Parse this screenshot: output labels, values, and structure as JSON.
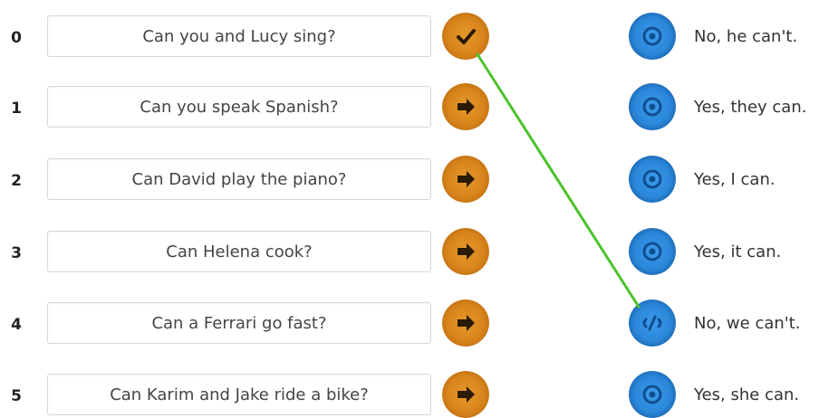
{
  "rows": [
    {
      "number": "0",
      "question": "Can you and Lucy sing?",
      "question_state": "checked",
      "answer": "No, he can't.",
      "answer_state": "empty"
    },
    {
      "number": "1",
      "question": "Can you speak Spanish?",
      "question_state": "arrow",
      "answer": "Yes, they can.",
      "answer_state": "empty"
    },
    {
      "number": "2",
      "question": "Can David play the piano?",
      "question_state": "arrow",
      "answer": "Yes, I can.",
      "answer_state": "empty"
    },
    {
      "number": "3",
      "question": "Can Helena cook?",
      "question_state": "arrow",
      "answer": "Yes, it can.",
      "answer_state": "empty"
    },
    {
      "number": "4",
      "question": "Can a Ferrari go fast?",
      "question_state": "arrow",
      "answer": "No, we can't.",
      "answer_state": "linked"
    },
    {
      "number": "5",
      "question": "Can Karim and Jake ride a bike?",
      "question_state": "arrow",
      "answer": "Yes, she can.",
      "answer_state": "empty"
    }
  ],
  "connection": {
    "from_row": 0,
    "to_row": 4
  },
  "colors": {
    "orange_button": "#d8841c",
    "blue_button": "#2a86d8",
    "connection_line": "#4cc22c"
  },
  "icons": {
    "question_checked": "check-icon",
    "question_default": "arrow-right-icon",
    "answer_default": "ring-target-icon",
    "answer_linked": "link-slash-icon"
  }
}
